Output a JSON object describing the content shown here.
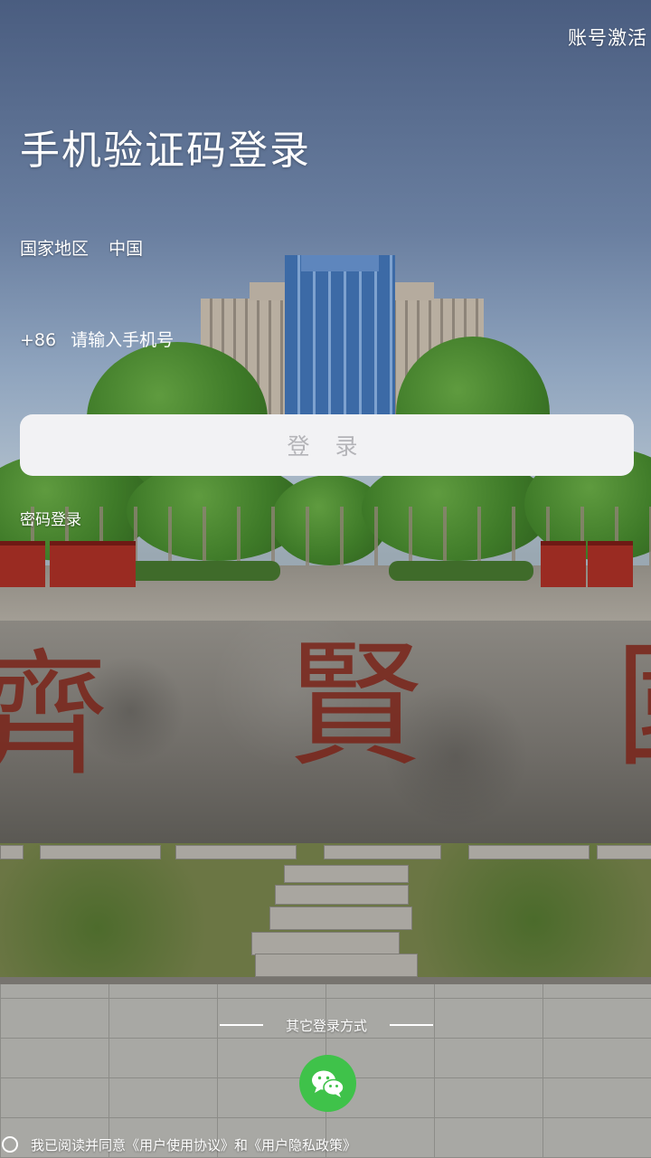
{
  "header": {
    "activate_label": "账号激活",
    "title": "手机验证码登录"
  },
  "form": {
    "region_label": "国家地区",
    "region_value": "中国",
    "country_code": "+86",
    "phone_placeholder": "请输入手机号",
    "phone_value": "",
    "login_label": "登 录",
    "password_login_label": "密码登录"
  },
  "other_login": {
    "label": "其它登录方式",
    "methods": [
      {
        "name": "wechat",
        "icon": "wechat-icon",
        "color": "#3fc24a"
      }
    ]
  },
  "agreement": {
    "prefix": "我已阅读并同意",
    "user_agreement": "《用户使用协议》",
    "and": "和",
    "privacy_policy": "《用户隐私政策》",
    "checked": false
  },
  "background": {
    "carved_chars": [
      "齊",
      "賢",
      "國"
    ]
  }
}
